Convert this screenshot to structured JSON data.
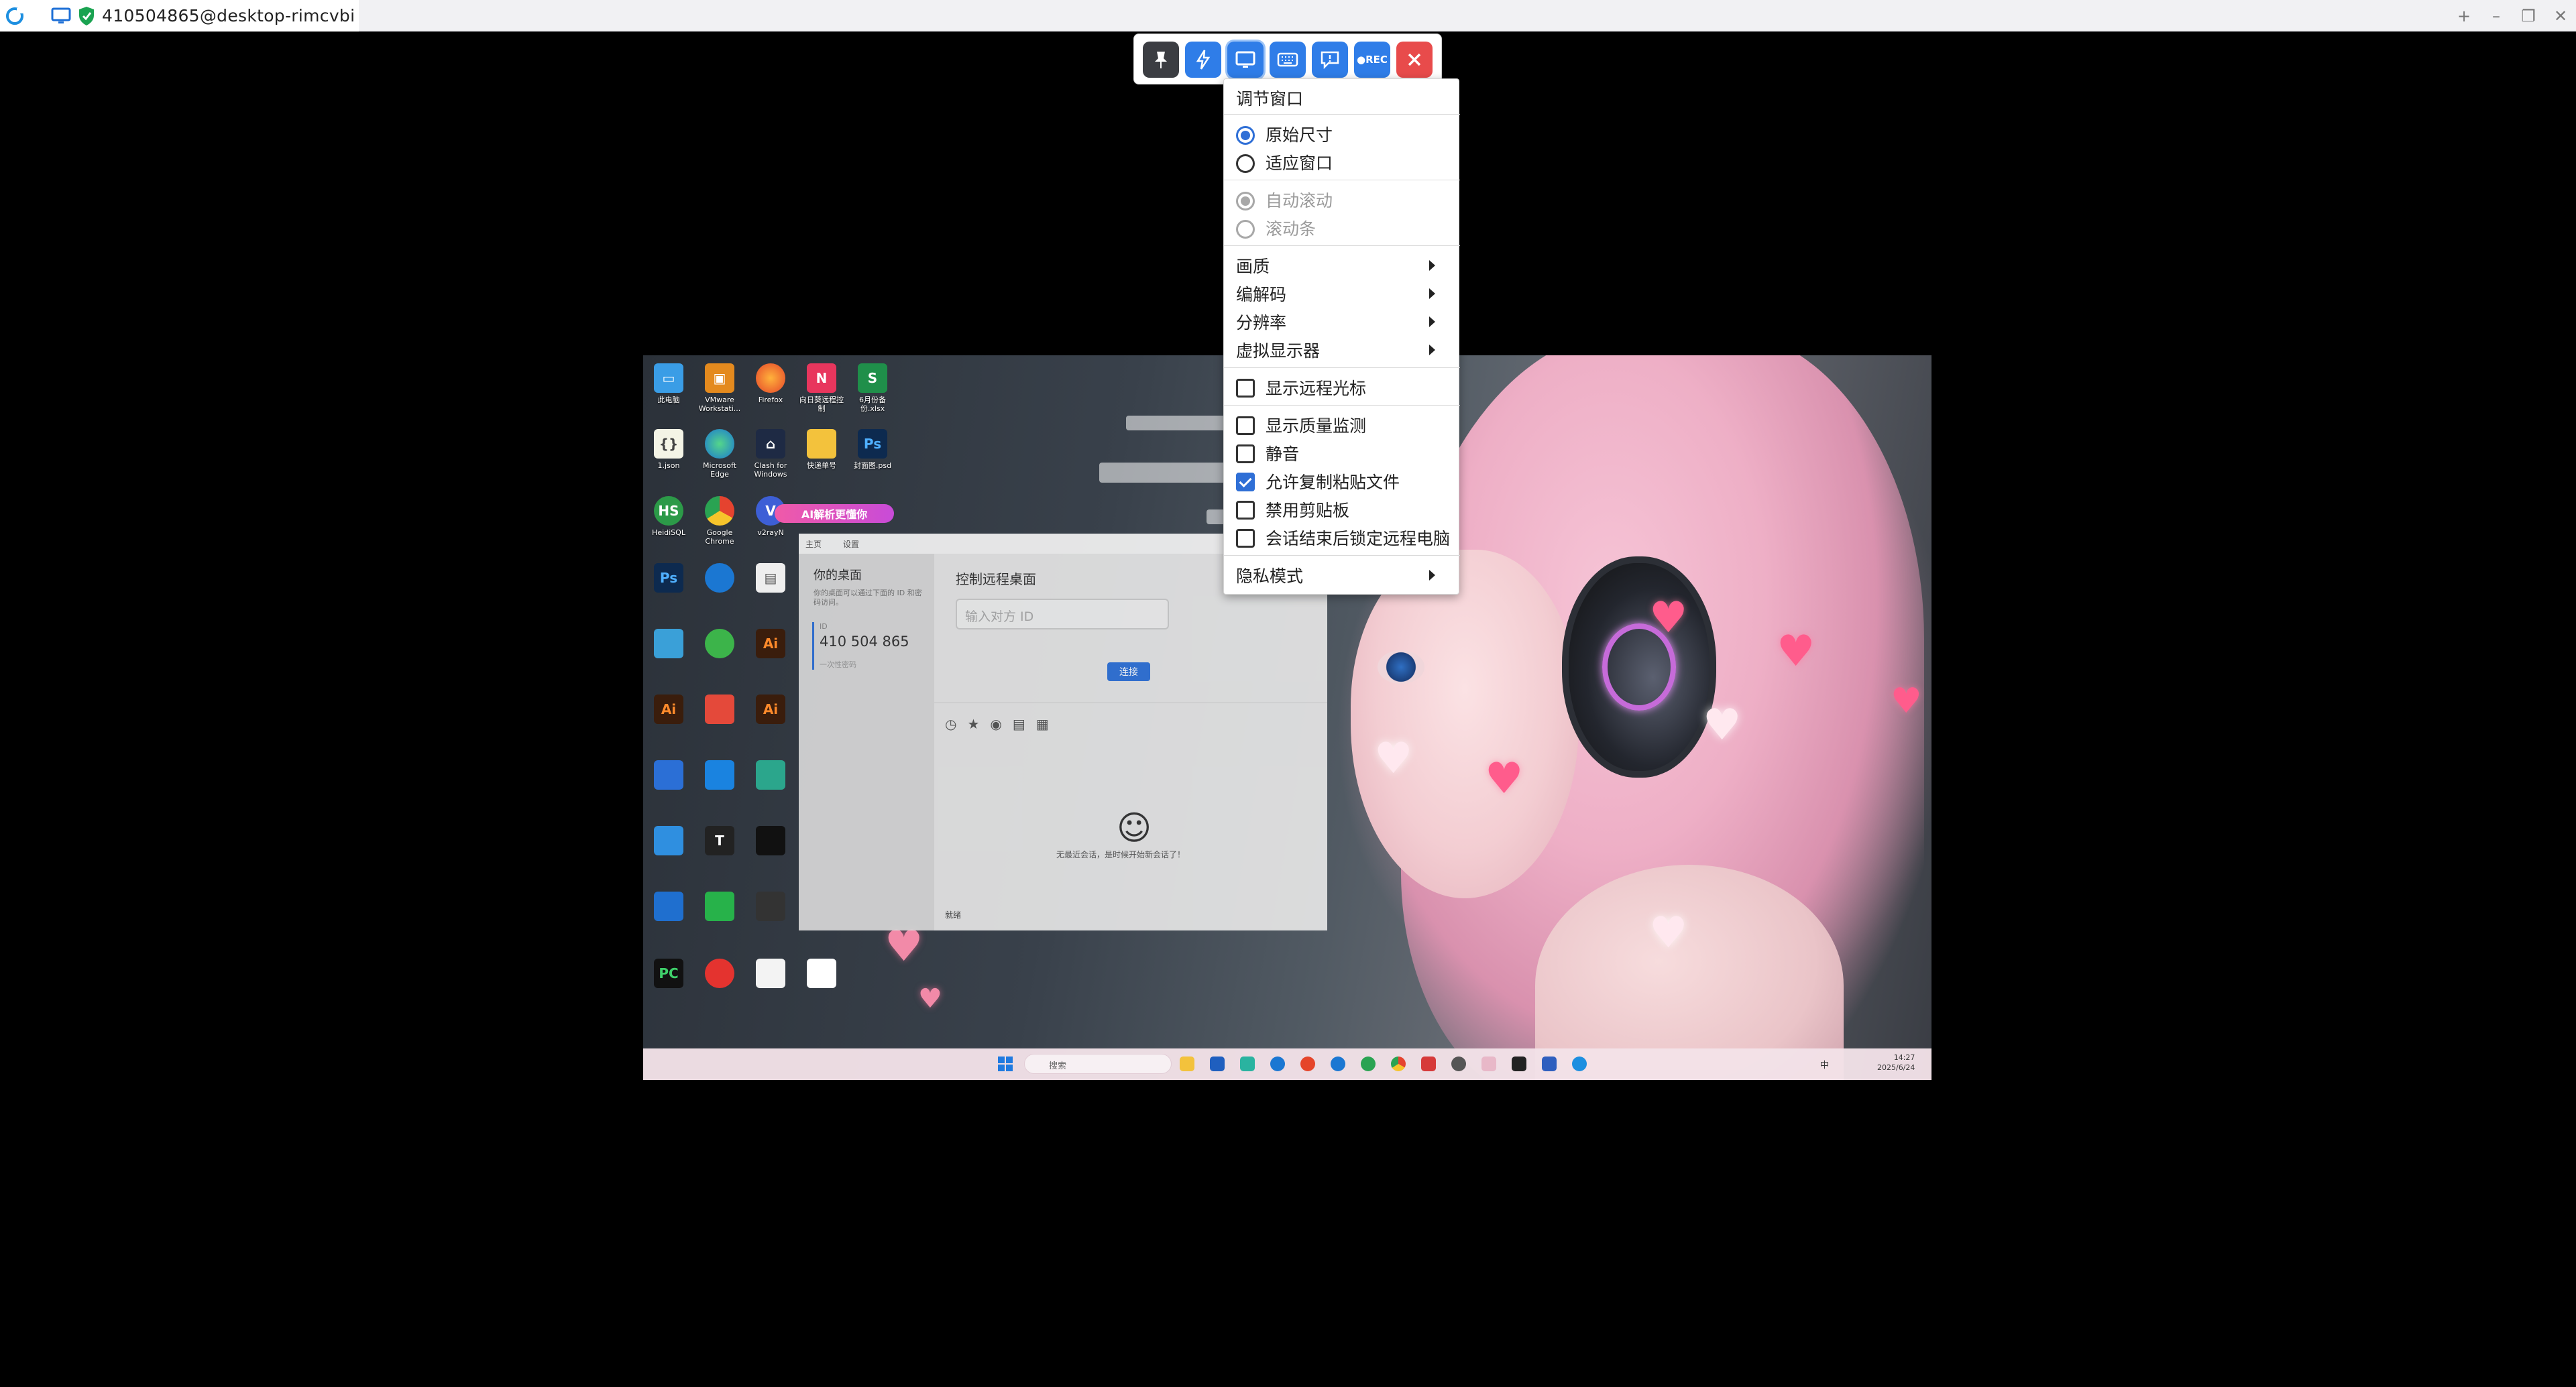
{
  "titlebar": {
    "tab_title": "410504865@desktop-rimcvbi",
    "add_tab": "+",
    "minimize": "–",
    "restore": "❐",
    "close": "✕"
  },
  "toolbar": {
    "buttons": [
      "pin-icon",
      "lightning-icon",
      "display-icon",
      "keyboard-icon",
      "chat-icon",
      "record-icon",
      "close-icon"
    ],
    "record_label": "●REC",
    "accent_color": "#2f7de8",
    "close_color": "#e84b4b"
  },
  "menu": {
    "header": "调节窗口",
    "radio_group_1": [
      {
        "label": "原始尺寸",
        "checked": true
      },
      {
        "label": "适应窗口",
        "checked": false
      }
    ],
    "radio_group_2": [
      {
        "label": "自动滚动",
        "checked": true,
        "disabled": true
      },
      {
        "label": "滚动条",
        "checked": false,
        "disabled": true
      }
    ],
    "submenus": [
      "画质",
      "编解码",
      "分辨率",
      "虚拟显示器"
    ],
    "check_1": {
      "label": "显示远程光标",
      "checked": false
    },
    "checks_2": [
      {
        "label": "显示质量监测",
        "checked": false
      },
      {
        "label": "静音",
        "checked": false
      },
      {
        "label": "允许复制粘贴文件",
        "checked": true
      },
      {
        "label": "禁用剪贴板",
        "checked": false
      },
      {
        "label": "会话结束后锁定远程电脑",
        "checked": false
      }
    ],
    "privacy": "隐私模式"
  },
  "remote_desktop": {
    "icons": [
      {
        "label": "此电脑"
      },
      {
        "label": "VMware Workstati..."
      },
      {
        "label": "Firefox"
      },
      {
        "label": "向日葵远程控制"
      },
      {
        "label": "6月份备份.xlsx"
      },
      {
        "label": "1.json"
      },
      {
        "label": "Microsoft Edge"
      },
      {
        "label": "Clash for Windows"
      },
      {
        "label": "快递单号"
      },
      {
        "label": "封面图.psd"
      },
      {
        "label": "HeidiSQL"
      },
      {
        "label": "Google Chrome"
      },
      {
        "label": "v2rayN"
      }
    ],
    "ai_pill": "AI解析更懂你",
    "rustdesk": {
      "tab_home": "主页",
      "tab_settings": "设置",
      "your_desktop": "你的桌面",
      "your_desktop_hint": "你的桌面可以通过下面的 ID 和密码访问。",
      "id_label": "ID",
      "id_value": "410 504 865",
      "password_label": "一次性密码",
      "control_title": "控制远程桌面",
      "input_placeholder": "输入对方 ID",
      "connect_button": "连接",
      "empty_text": "无最近会话，是时候开始新会话了！",
      "status": "就绪"
    },
    "taskbar": {
      "search_placeholder": "搜索",
      "time": "14:27",
      "date": "2025/6/24",
      "ime": "中"
    }
  }
}
